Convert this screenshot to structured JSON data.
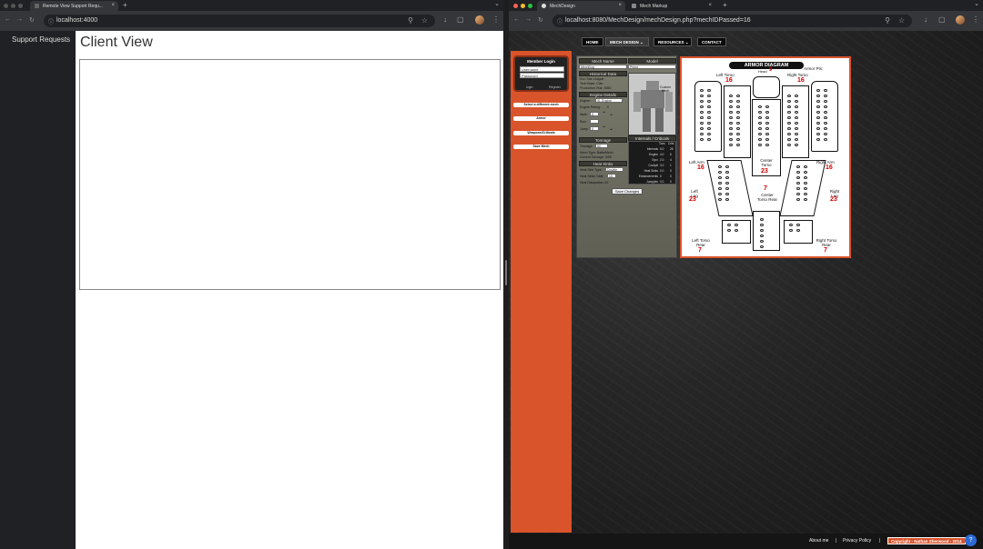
{
  "left_browser": {
    "tab_title": "Remote View Support Requ...",
    "url": "localhost:4000",
    "sidebar": {
      "items": [
        {
          "label": "Support Requests"
        }
      ]
    },
    "page_title": "Client View"
  },
  "right_browser": {
    "tabs": [
      {
        "title": "MechDesign"
      },
      {
        "title": "Mech Markup"
      }
    ],
    "url": "localhost:8080/MechDesign/mechDesign.php?mechIDPassed=16",
    "nav": {
      "home": "HOME",
      "mech_design": "MECH DESIGN",
      "resources": "RESOURCES",
      "contact": "CONTACT"
    },
    "login": {
      "title": "Member Login",
      "username_placeholder": "Username",
      "password_placeholder": "Password",
      "login_label": "login",
      "register_label": "Register"
    },
    "side_buttons": {
      "select_mech": "Select a different mech",
      "armor": "Armor",
      "weapons": "Weapons/Criticals",
      "save": "Save Mech"
    },
    "panel": {
      "mech_name_header": "Mech Name",
      "model_header": "Model",
      "mech_name_value": "MechDog",
      "model_value": "Prime",
      "historical_header": "Historical Data",
      "era": "Era: Star League",
      "tech_base": "Tech Base: Clan",
      "production_year": "Production Year: 3050",
      "engine_header": "Engine Details",
      "engine_label": "Engine:",
      "engine_value": "XL Engine",
      "engine_rating": "Engine Rating:",
      "engine_rating_value": "0",
      "walk_label": "Walk:",
      "walk_value": "5",
      "run_label": "Run:",
      "jump_label": "Jump:",
      "jump_value": "0",
      "custom_mech": "Custom Mech",
      "tonnage_header": "Tonnage",
      "tonnage_label": "Tonnage:",
      "tonnage_value": "50",
      "mech_type": "Mech Type: BattleMech",
      "current_tonnage": "Current Tonnage: 0/50",
      "heat_header": "Heat Sinks",
      "heat_sink_type": "Heat Sink Type:",
      "heat_sink_type_value": "Double",
      "heat_sinks_total": "Heat Sinks Total:",
      "heat_sinks_total_value": "10",
      "heat_dissipation": "Heat Dissipation: 20",
      "internals_header": "Internals / Criticals",
      "crit_head_tons": "Tons",
      "crit_head_crits": "Crits",
      "crit_rows": [
        {
          "name": "Internals",
          "tons": "5.0",
          "crits": "28"
        },
        {
          "name": "Engine",
          "tons": "4.0",
          "crits": "6"
        },
        {
          "name": "Gyro",
          "tons": "2.0",
          "crits": "4"
        },
        {
          "name": "Cockpit",
          "tons": "3.0",
          "crits": "1"
        },
        {
          "name": "Heat Sinks",
          "tons": "0.0",
          "crits": "0"
        },
        {
          "name": "Enhancements",
          "tons": "0",
          "crits": "0"
        },
        {
          "name": "Jumpjets",
          "tons": "0.0",
          "crits": "0"
        }
      ],
      "save_changes": "Save Changes"
    },
    "armor": {
      "title": "ARMOR DIAGRAM",
      "armor_pts_label": "Armor Pts:",
      "head_label": "Head",
      "head_value": "9",
      "left_torso_label": "Left Torso",
      "left_torso_value": "16",
      "right_torso_label": "Right Torso",
      "right_torso_value": "16",
      "left_arm_label": "Left Arm",
      "left_arm_value": "16",
      "right_arm_label": "Right Arm",
      "right_arm_value": "16",
      "center_torso_label": "Center Torso",
      "center_torso_value": "23",
      "left_leg_label": "Left Leg",
      "left_leg_value": "23",
      "right_leg_label": "Right Leg",
      "right_leg_value": "23",
      "center_torso_rear_label": "Center Torso Rear",
      "center_torso_rear_value": "7",
      "left_torso_rear_label": "Left Torso Rear",
      "left_torso_rear_value": "7",
      "right_torso_rear_label": "Right Torso Rear",
      "right_torso_rear_value": "7"
    },
    "footer": {
      "about": "About me",
      "sep": "|",
      "privacy": "Privacy Policy",
      "copyright": "Copyright - Nathan Sherwood - 2014",
      "help": "?"
    }
  }
}
